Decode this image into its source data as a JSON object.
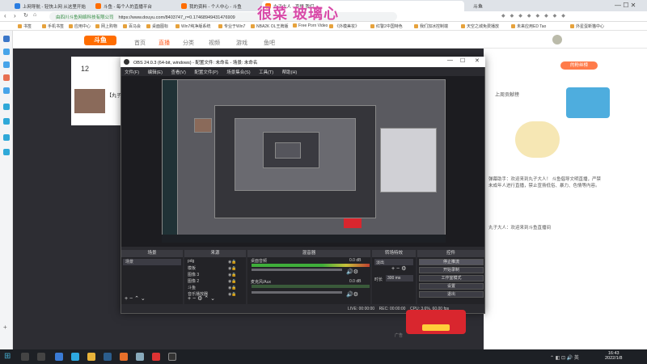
{
  "browser": {
    "tabs": [
      {
        "label": "上网导航 - 轻快上网 从这里开始"
      },
      {
        "label": "斗鱼 - 每个人的直播平台"
      },
      {
        "label": "我的资料 - 个人中心 - 斗鱼"
      },
      {
        "label": "丸子大人 - 直播 我们..."
      }
    ],
    "right_tab": "斗鱼",
    "address_prefix": "由四川斗鱼网络科技有限公司",
    "address": "https://www.douyu.com/8403747_r=0.17468949431476909",
    "bookmarks": [
      "书签",
      "手机书签",
      "应用中心",
      "网上购物",
      "百马会",
      "桌面图标",
      "Win7纯净版系统",
      "专业于Win7",
      "NBA2K OL王牌版",
      "Free Porn Video",
      "《外模美妆》",
      "红警2中国特色",
      "我们加冰控制端",
      "天空之城免费播放",
      "未来应用ED Tao",
      "外星蛋新猫中心"
    ]
  },
  "site": {
    "logo": "斗鱼",
    "nav": [
      "首页",
      "直播",
      "分类",
      "视频",
      "游戏",
      "鱼吧"
    ],
    "nav_active": "直播",
    "count": "12",
    "room_title": "【丸子",
    "right_badge": "的粉丝榜",
    "user_label": "上周贡献榜",
    "chat": [
      "弹幕助手：欢迎来到丸子大人！ 斗鱼倡导文明直播，严禁未成年人进行直播，禁止宣扬低俗、暴力、色情等内容。",
      "丸子大人：欢迎来到斗鱼直播间"
    ]
  },
  "watermark": "很菜 玻璃心",
  "obs": {
    "title": "OBS 24.0.3 (64-bit, windows) - 配置文件: 未命名 - 场景: 未命名",
    "menu": [
      "文件(F)",
      "编辑(E)",
      "查看(V)",
      "配置文件(P)",
      "场景集合(S)",
      "工具(T)",
      "帮助(H)"
    ],
    "docks": {
      "scenes": "场景",
      "sources": "来源",
      "mixer": "混音器",
      "transitions": "转场特效",
      "controls": "控件"
    },
    "scene_items": [
      "场景"
    ],
    "source_items": [
      "pdg",
      "模板",
      "图像 3",
      "图像 2",
      "斗鱼",
      "音乐播放器"
    ],
    "mixer_channels": [
      {
        "name": "桌面音频",
        "db": "0.0 dB"
      },
      {
        "name": "麦克风/Aux",
        "db": "0.0 dB"
      }
    ],
    "transition": {
      "select": "淡出",
      "duration_label": "时长",
      "duration": "300 ms"
    },
    "control_buttons": [
      "停止推流",
      "开始录制",
      "工作室模式",
      "设置",
      "退出"
    ],
    "status": {
      "live": "LIVE: 00:00:00",
      "rec": "REC: 00:00:00",
      "cpu": "CPU: 3.6%, 60.00 fps"
    }
  },
  "ad_label": "广告",
  "taskbar": {
    "time": "16:43",
    "date": "2022/1/8"
  }
}
